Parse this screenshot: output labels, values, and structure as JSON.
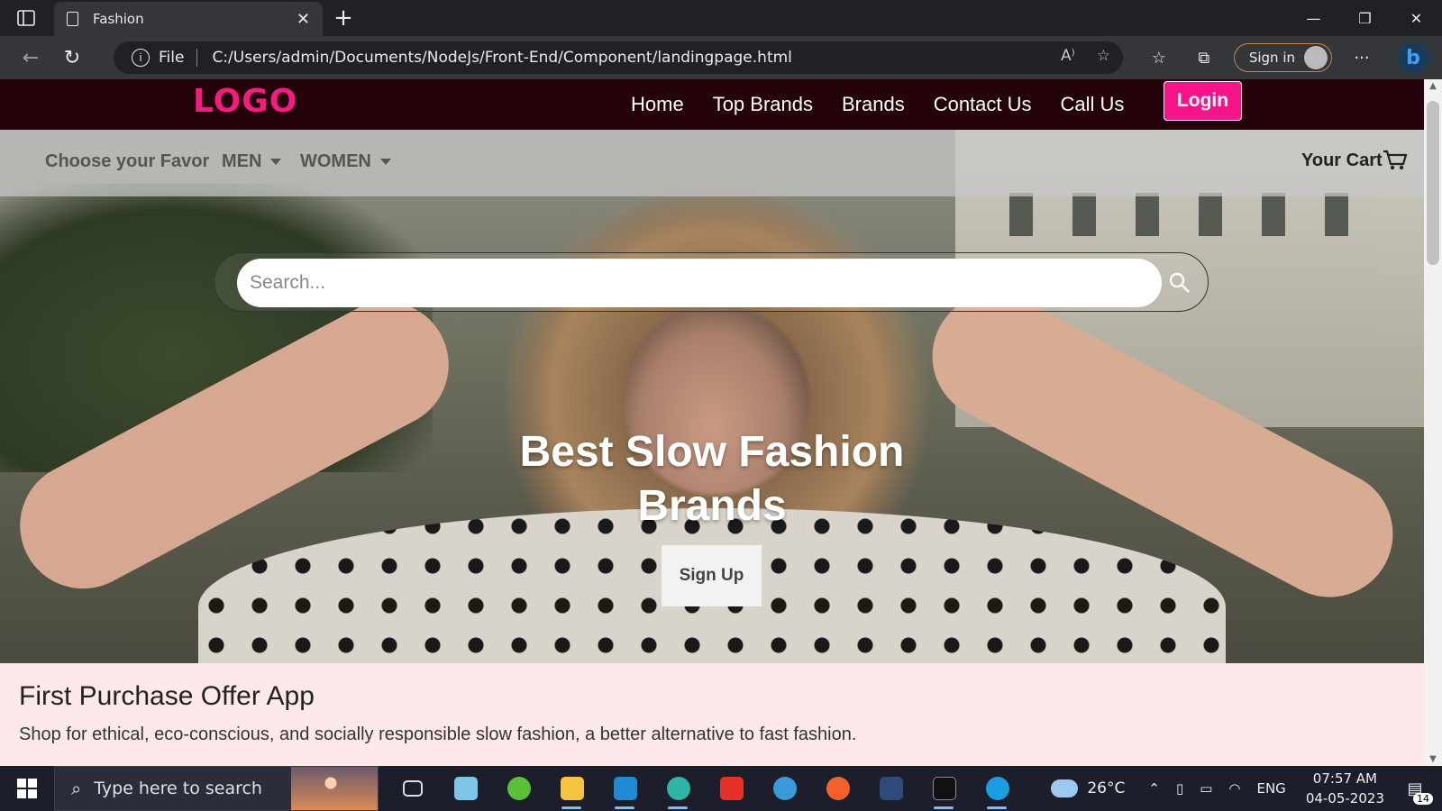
{
  "browser": {
    "tab_title": "Fashion",
    "url_prefix": "File",
    "url": "C:/Users/admin/Documents/NodeJs/Front-End/Component/landingpage.html",
    "signin_label": "Sign in"
  },
  "page": {
    "logo": "LOGO",
    "nav": [
      "Home",
      "Top Brands",
      "Brands",
      "Contact Us",
      "Call Us"
    ],
    "login_label": "Login",
    "subnav": {
      "favor": "Choose your Favor",
      "men": "MEN",
      "women": "WOMEN",
      "cart": "Your Cart"
    },
    "search_placeholder": "Search...",
    "headline": "Best Slow Fashion Brands",
    "signup_label": "Sign Up",
    "offer": {
      "title": "First Purchase Offer App",
      "text": "Shop for ethical, eco-conscious, and socially responsible slow fashion, a better alternative to fast fashion."
    },
    "accent_color": "#f21d7f",
    "nav_bg": "#24030a"
  },
  "taskbar": {
    "search_placeholder": "Type here to search",
    "weather": "26°C",
    "lang": "ENG",
    "time": "07:57 AM",
    "date": "04-05-2023",
    "notifications": "14",
    "apps": [
      "task-view",
      "notepad",
      "node-app",
      "file-explorer",
      "vscode",
      "edge",
      "wps-office",
      "edge-dev",
      "pencil-app",
      "network-app",
      "terminal",
      "edge-browser"
    ]
  }
}
